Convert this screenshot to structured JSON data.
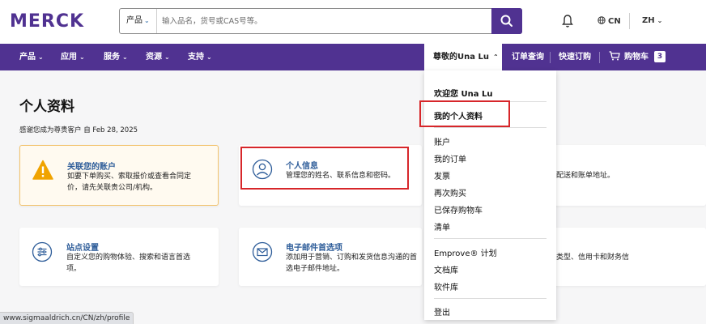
{
  "header": {
    "logo": "MERCK",
    "search": {
      "category": "产品",
      "placeholder": "输入品名，货号或CAS号等。"
    },
    "language": "CN",
    "locale": "ZH"
  },
  "nav": {
    "items": [
      "产品",
      "应用",
      "服务",
      "资源",
      "支持"
    ],
    "user_menu": "尊敬的Una Lu",
    "order_lookup": "订单查询",
    "quick_order": "快速订购",
    "cart_label": "购物车",
    "cart_count": "3"
  },
  "main": {
    "title": "个人资料",
    "member_since": "感谢您成为尊贵客户 自 Feb 28, 2025",
    "cards": {
      "link_account": {
        "title": "关联您的账户",
        "desc_line1": "如要下单购买、索取报价或查看合同定",
        "desc_line2": "价，请先关联贵公司/机构。"
      },
      "personal_info": {
        "title": "个人信息",
        "desc": "管理您的姓名、联系信息和密码。"
      },
      "address_partial": {
        "desc": "配送和账单地址。"
      },
      "site_settings": {
        "title": "站点设置",
        "desc_line1": "自定义您的购物体验、搜索和语言首选",
        "desc_line2": "项。"
      },
      "email_prefs": {
        "title": "电子邮件首选项",
        "desc_line1": "添加用于营销、订购和发货信息沟通的首",
        "desc_line2": "选电子邮件地址。"
      },
      "payment_partial": {
        "desc": "类型、信用卡和财务信"
      }
    }
  },
  "dropdown": {
    "greeting": "欢迎您 Una Lu",
    "profile": "我的个人资料",
    "items_group1": [
      "账户",
      "我的订单",
      "发票",
      "再次购买",
      "已保存购物车",
      "清单"
    ],
    "items_group2": [
      "Emprove® 计划",
      "文档库",
      "软件库"
    ],
    "logout": "登出"
  },
  "status_bar": {
    "url": "www.sigmaaldrich.cn/CN/zh/profile"
  },
  "colors": {
    "brand_purple": "#503291",
    "link_blue": "#2d5c99",
    "warning": "#f0a300",
    "highlight_red": "#d7262a"
  }
}
